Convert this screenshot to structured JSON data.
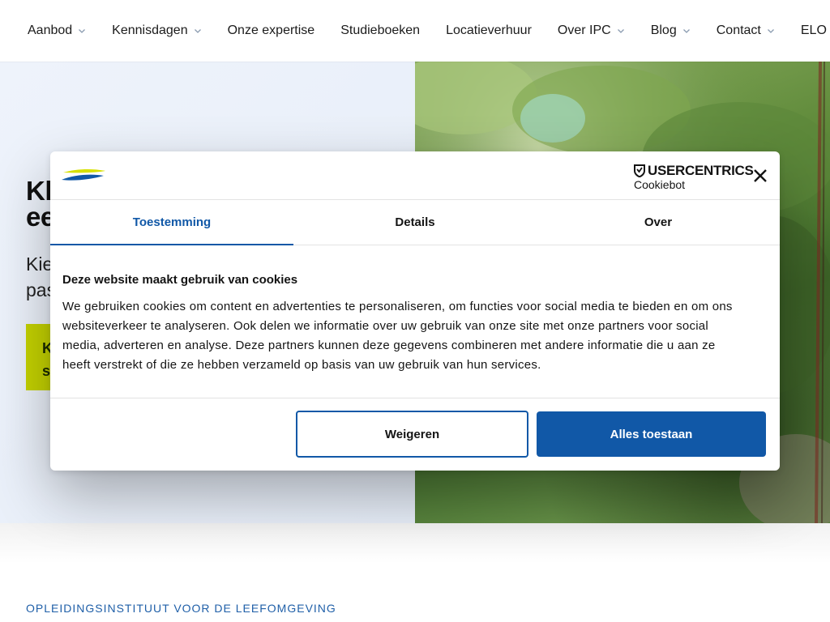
{
  "nav": {
    "items": [
      {
        "label": "Aanbod",
        "has_dropdown": true
      },
      {
        "label": "Kennisdagen",
        "has_dropdown": true
      },
      {
        "label": "Onze expertise",
        "has_dropdown": false
      },
      {
        "label": "Studieboeken",
        "has_dropdown": false
      },
      {
        "label": "Locatieverhuur",
        "has_dropdown": false
      },
      {
        "label": "Over IPC",
        "has_dropdown": true
      },
      {
        "label": "Blog",
        "has_dropdown": true
      },
      {
        "label": "Contact",
        "has_dropdown": true
      },
      {
        "label": "ELO",
        "has_dropdown": false
      }
    ]
  },
  "hero": {
    "title_line1": "Kl",
    "title_line2": "ee",
    "subtitle_line1": "Kie",
    "subtitle_line2": "pas",
    "cta_line1": "K",
    "cta_line2": "s"
  },
  "section": {
    "kicker": "OPLEIDINGSINSTITUUT VOOR DE LEEFOMGEVING"
  },
  "cookie_dialog": {
    "brand_top": "USERCENTRICS",
    "brand_bottom": "Cookiebot",
    "tabs": [
      {
        "label": "Toestemming",
        "active": true
      },
      {
        "label": "Details",
        "active": false
      },
      {
        "label": "Over",
        "active": false
      }
    ],
    "heading": "Deze website maakt gebruik van cookies",
    "text_lines": [
      "We gebruiken cookies om content en advertenties te personaliseren, om functies voor social media te bieden en om ons",
      "websiteverkeer te analyseren. Ook delen we informatie over uw gebruik van onze site met onze partners voor social",
      "media, adverteren en analyse. Deze partners kunnen deze gegevens combineren met andere informatie die u aan ze",
      "heeft verstrekt of die ze hebben verzameld op basis van uw gebruik van hun services."
    ],
    "decline_label": "Weigeren",
    "accept_label": "Alles toestaan"
  },
  "colors": {
    "accent": "#1158a7",
    "cta": "#c5d300",
    "kicker": "#1f5fa8"
  }
}
